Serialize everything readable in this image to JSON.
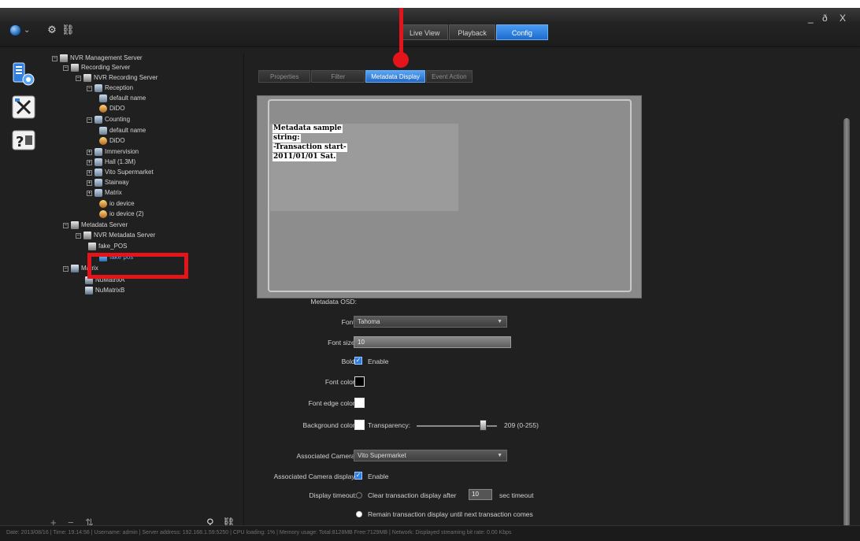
{
  "window_controls": {
    "minimize": "_",
    "restore": "ð",
    "close": "X"
  },
  "main_tabs": [
    {
      "label": "Live View",
      "active": false
    },
    {
      "label": "Playback",
      "active": false
    },
    {
      "label": "Config",
      "active": true
    }
  ],
  "icons": {
    "logo": "globe-icon",
    "toolbar": [
      "add-device-icon",
      "link-icon"
    ],
    "side": [
      "device-config-icon",
      "tools-icon",
      "help-icon"
    ]
  },
  "tree": {
    "root": "NVR Management Server",
    "recording_server": "Recording Server",
    "nvr_recording_server": "NVR Recording Server",
    "reception": "Reception",
    "reception_default": "default name",
    "reception_dido": "DiDO",
    "counting": "Counting",
    "counting_default": "default name",
    "counting_dido": "DiDO",
    "immervision": "Immervision",
    "hall": "Hall (1.3M)",
    "vito": "Vito Supermarket",
    "stairway": "Stairway",
    "matrix": "Matrix",
    "io_device": "io device",
    "io_device_2": "io device (2)",
    "metadata_server": "Metadata Server",
    "nvr_metadata_server": "NVR Metadata Server",
    "fake_pos_parent": "fake_POS",
    "fake_pos": "fake pos",
    "matrix_group": "Matrix",
    "numatrix_a": "NuMatrixA",
    "numatrix_b": "NuMatrixB"
  },
  "tree_footer": {
    "add": "+",
    "remove": "−",
    "sort": "⇅",
    "search": "⚲",
    "link": "⛓"
  },
  "sub_tabs": [
    {
      "label": "Properties",
      "active": false
    },
    {
      "label": "Filter",
      "active": false
    },
    {
      "label": "Metadata Display",
      "active": true
    },
    {
      "label": "Event Action",
      "active": false
    }
  ],
  "preview": {
    "lines": [
      "Metadata sample",
      "string:",
      "-Transaction start-",
      "2011/01/01 Sat."
    ]
  },
  "form": {
    "section_label": "Metadata OSD:",
    "font_label": "Font:",
    "font_value": "Tahoma",
    "font_size_label": "Font size:",
    "font_size_value": "10",
    "bold_label": "Bold:",
    "bold_enable": "Enable",
    "font_color_label": "Font color:",
    "font_edge_color_label": "Font edge color:",
    "bg_color_label": "Background color:",
    "transparency_label": "Transparency:",
    "transparency_value": "209 (0-255)",
    "transparency_fraction": 0.82,
    "assoc_camera_label": "Associated Camera:",
    "assoc_camera_value": "Vito Supermarket",
    "assoc_camera_display_label": "Associated Camera display:",
    "assoc_camera_display_enable": "Enable",
    "display_timeout_label": "Display timeout:",
    "clear_option": "Clear transaction display after",
    "timeout_value": "10",
    "timeout_unit": "sec timeout",
    "remain_option": "Remain transaction display until next transaction comes"
  },
  "colors": {
    "accent": "#2a7ae0",
    "annotation_red": "#e3141a",
    "font_color": "#000000",
    "font_edge_color": "#ffffff",
    "background_color": "#ffffff"
  },
  "status": "Date: 2013/08/16 | Time: 19:14:56 | Username: admin | Server address: 192.168.1.59:5250 | CPU loading: 1% | Memory usage: Total:8128MB Free:7129MB | Network: Displayed streaming bit rate: 0.00 Kbps"
}
